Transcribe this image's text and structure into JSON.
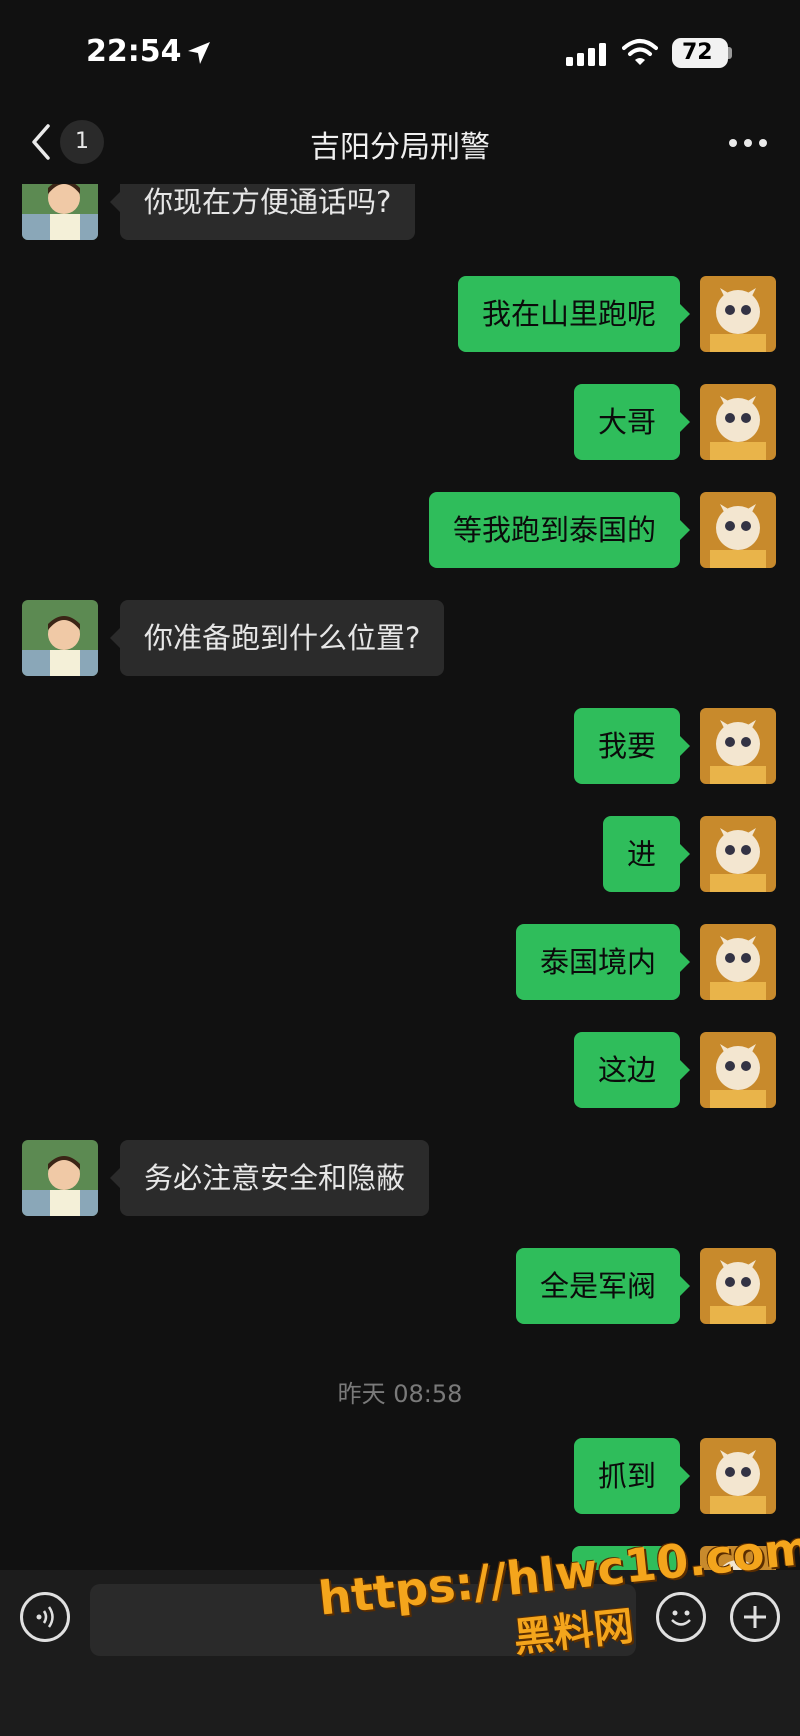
{
  "status_bar": {
    "time": "22:54",
    "battery": "72"
  },
  "nav": {
    "back_count": "1",
    "title": "吉阳分局刑警"
  },
  "messages": [
    {
      "side": "left",
      "text": "你现在方便通话吗?"
    },
    {
      "side": "right",
      "text": "我在山里跑呢"
    },
    {
      "side": "right",
      "text": "大哥"
    },
    {
      "side": "right",
      "text": "等我跑到泰国的"
    },
    {
      "side": "left",
      "text": "你准备跑到什么位置?"
    },
    {
      "side": "right",
      "text": "我要"
    },
    {
      "side": "right",
      "text": "进"
    },
    {
      "side": "right",
      "text": "泰国境内"
    },
    {
      "side": "right",
      "text": "这边"
    },
    {
      "side": "left",
      "text": "务必注意安全和隐蔽"
    },
    {
      "side": "right",
      "text": "全是军阀"
    },
    {
      "side": "right",
      "text": "抓到"
    }
  ],
  "timestamp": "昨天 08:58",
  "watermark": {
    "url": "https://hlwc10.com",
    "name": "黑料网"
  },
  "icons": {
    "back": "chevron-left-icon",
    "more": "more-dots-icon",
    "voice": "voice-icon",
    "emoji": "emoji-icon",
    "plus": "plus-icon"
  },
  "colors": {
    "background": "#111111",
    "sent_bubble": "#2fbd5b",
    "received_bubble": "#2b2b2b",
    "watermark": "#f4a51c"
  }
}
